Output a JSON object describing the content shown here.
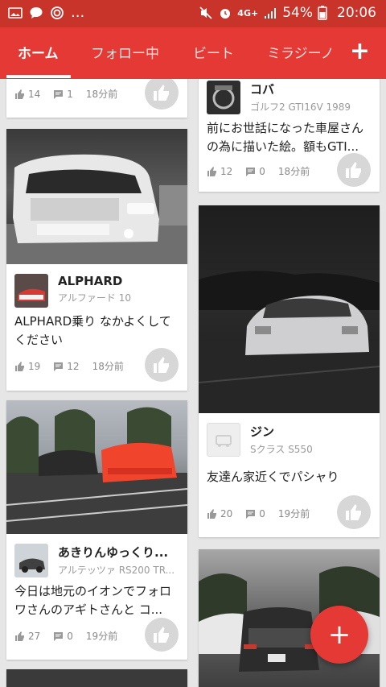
{
  "status": {
    "battery": "54%",
    "time": "20:06",
    "signal": "4G+",
    "more": "..."
  },
  "tabs": [
    "ホーム",
    "フォロー中",
    "ビート",
    "ミラジーノ"
  ],
  "tab_add": "+",
  "posts": {
    "p0": {
      "likes": "14",
      "comments": "1",
      "time": "18分前"
    },
    "p1": {
      "user": "ALPHARD",
      "car": "アルファード 10",
      "text": "ALPHARD乗り なかよくしてください",
      "likes": "19",
      "comments": "12",
      "time": "18分前"
    },
    "p2": {
      "user": "あきりんゆっくり...",
      "car": "アルテッツァ RS200 TR...",
      "text": "今日は地元のイオンでフォロワさんのアギトさんと コ...",
      "likes": "27",
      "comments": "0",
      "time": "19分前"
    },
    "p3": {
      "user": "コバ",
      "car": "ゴルフ2 GTI16V 1989",
      "text": "前にお世話になった車屋さんの為に描いた絵。額もGTI...",
      "likes": "12",
      "comments": "0",
      "time": "18分前"
    },
    "p4": {
      "user": "ジン",
      "car": "Sクラス S550",
      "text": "友達ん家近くでパシャり",
      "likes": "20",
      "comments": "0",
      "time": "19分前"
    }
  },
  "fab": "+",
  "colors": {
    "accent": "#e53935",
    "statusbar": "#c8332a"
  }
}
